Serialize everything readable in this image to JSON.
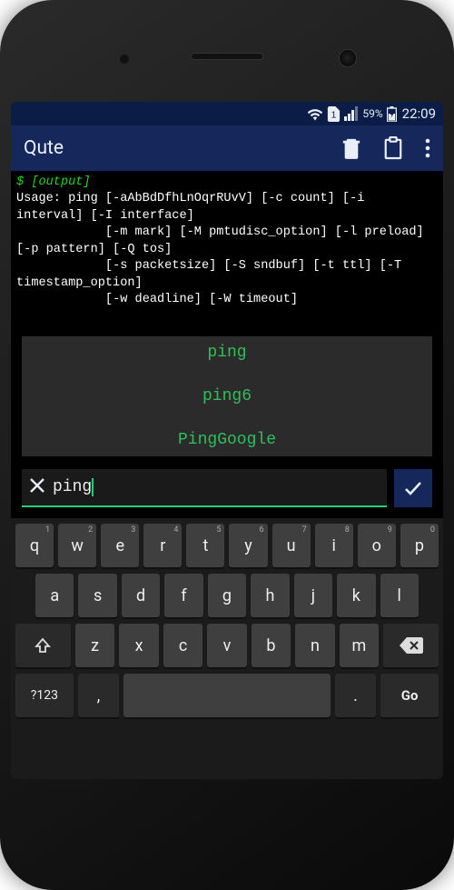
{
  "status": {
    "battery_percent": "59%",
    "time": "22:09",
    "sim_label": "1"
  },
  "appbar": {
    "title": "Qute"
  },
  "terminal": {
    "prompt": "$ [output]",
    "lines": [
      "Usage: ping [-aAbBdDfhLnOqrRUvV] [-c count] [-i interval] [-I interface]",
      "            [-m mark] [-M pmtudisc_option] [-l preload] [-p pattern] [-Q tos]",
      "            [-s packetsize] [-S sndbuf] [-t ttl] [-T timestamp_option]",
      "            [-w deadline] [-W timeout]"
    ]
  },
  "suggestions": [
    "ping",
    "ping6",
    "PingGoogle"
  ],
  "input": {
    "value": "ping"
  },
  "keyboard": {
    "row1": [
      {
        "k": "q",
        "s": "1"
      },
      {
        "k": "w",
        "s": "2"
      },
      {
        "k": "e",
        "s": "3"
      },
      {
        "k": "r",
        "s": "4"
      },
      {
        "k": "t",
        "s": "5"
      },
      {
        "k": "y",
        "s": "6"
      },
      {
        "k": "u",
        "s": "7"
      },
      {
        "k": "i",
        "s": "8"
      },
      {
        "k": "o",
        "s": "9"
      },
      {
        "k": "p",
        "s": "0"
      }
    ],
    "row2": [
      "a",
      "s",
      "d",
      "f",
      "g",
      "h",
      "j",
      "k",
      "l"
    ],
    "row3": [
      "z",
      "x",
      "c",
      "v",
      "b",
      "n",
      "m"
    ],
    "symkey": "?123",
    "comma": ",",
    "period": ".",
    "go": "Go"
  }
}
